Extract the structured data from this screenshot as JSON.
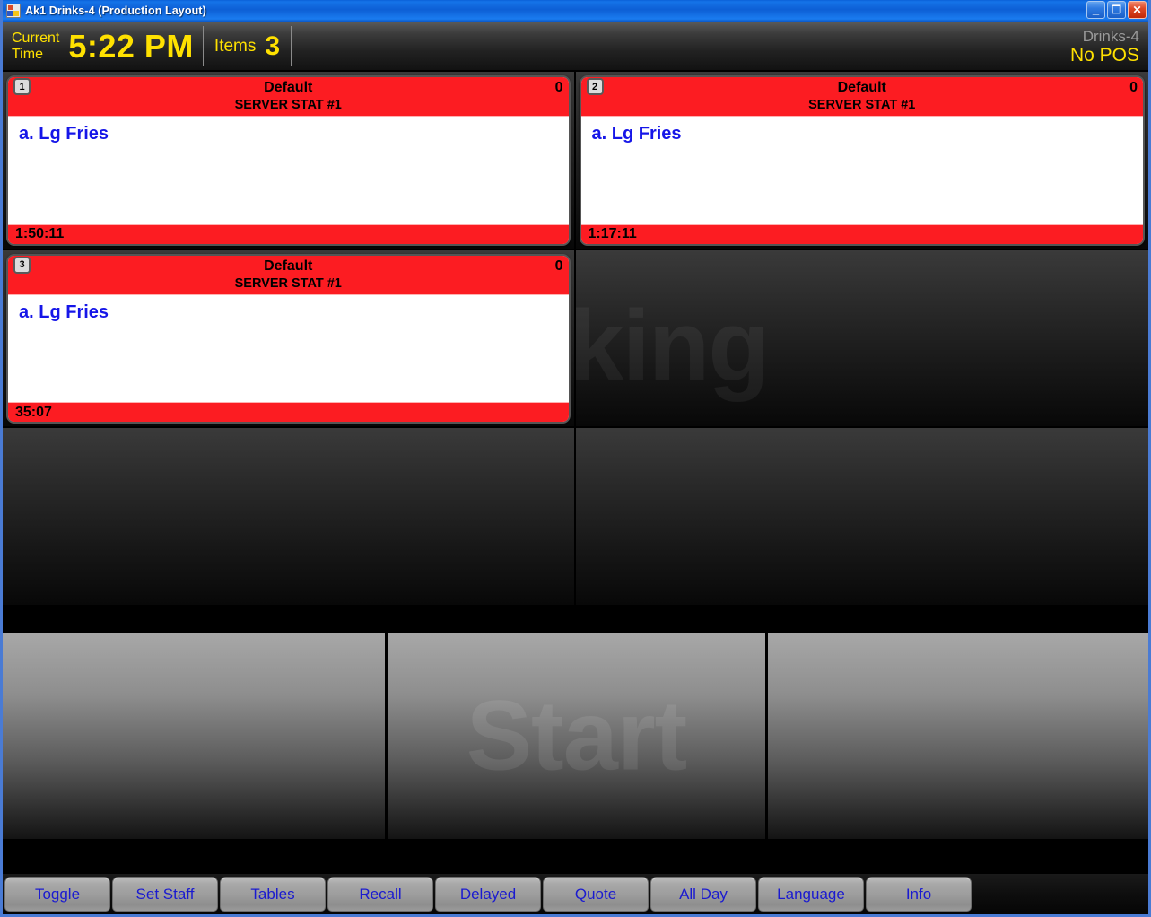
{
  "window": {
    "title": "Ak1 Drinks-4 (Production Layout)",
    "icon": "app-icon",
    "controls": {
      "minimize": "_",
      "restore": "❐",
      "close": "✕"
    }
  },
  "status": {
    "current_time_label_line1": "Current",
    "current_time_label_line2": "Time",
    "current_time": "5:22 PM",
    "items_label": "Items",
    "items_count": "3",
    "station": "Drinks-4",
    "pos_status": "No POS",
    "accent_yellow": "#ffe100",
    "station_gray": "#9a9a9a"
  },
  "grid": {
    "columns": 2,
    "rows": 3,
    "cells": [
      {
        "kind": "ticket",
        "badge": "1",
        "title": "Default",
        "count": "0",
        "subtitle": "SERVER STAT #1",
        "items": [
          "a. Lg Fries"
        ],
        "timer": "1:50:11",
        "header_color": "#fc1c22",
        "item_color": "#1616e8"
      },
      {
        "kind": "ticket",
        "badge": "2",
        "title": "Default",
        "count": "0",
        "subtitle": "SERVER STAT #1",
        "items": [
          "a. Lg Fries"
        ],
        "timer": "1:17:11",
        "header_color": "#fc1c22",
        "item_color": "#1616e8"
      },
      {
        "kind": "ticket",
        "badge": "3",
        "title": "Default",
        "count": "0",
        "subtitle": "SERVER STAT #1",
        "items": [
          "a. Lg Fries"
        ],
        "timer": "35:07",
        "header_color": "#fc1c22",
        "item_color": "#1616e8"
      },
      {
        "kind": "empty",
        "watermark": "king"
      },
      {
        "kind": "empty",
        "watermark": ""
      },
      {
        "kind": "empty",
        "watermark": ""
      }
    ]
  },
  "lower_panels": [
    {
      "watermark": ""
    },
    {
      "watermark": "Start"
    },
    {
      "watermark": ""
    }
  ],
  "toolbar": {
    "buttons": [
      {
        "label": "Toggle"
      },
      {
        "label": "Set Staff"
      },
      {
        "label": "Tables"
      },
      {
        "label": "Recall"
      },
      {
        "label": "Delayed"
      },
      {
        "label": "Quote"
      },
      {
        "label": "All Day"
      },
      {
        "label": "Language"
      },
      {
        "label": "Info"
      }
    ],
    "label_color": "#1a1ad0"
  }
}
